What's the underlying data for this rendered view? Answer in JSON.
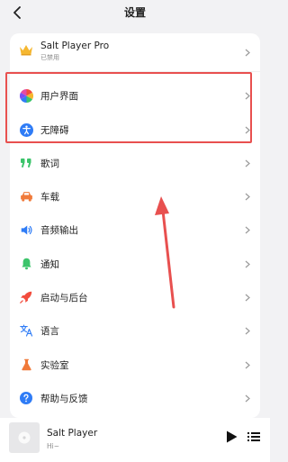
{
  "header": {
    "title": "设置"
  },
  "pro": {
    "title": "Salt Player Pro",
    "subtitle": "已禁用"
  },
  "settings": {
    "items": [
      {
        "label": "用户界面",
        "icon": "color-wheel-icon"
      },
      {
        "label": "无障碍",
        "icon": "accessibility-icon"
      },
      {
        "label": "歌词",
        "icon": "quote-icon"
      },
      {
        "label": "车载",
        "icon": "car-icon"
      },
      {
        "label": "音频输出",
        "icon": "speaker-icon"
      },
      {
        "label": "通知",
        "icon": "bell-icon"
      },
      {
        "label": "启动与后台",
        "icon": "rocket-icon"
      },
      {
        "label": "语言",
        "icon": "translate-icon"
      },
      {
        "label": "实验室",
        "icon": "flask-icon"
      },
      {
        "label": "帮助与反馈",
        "icon": "help-icon"
      }
    ]
  },
  "player": {
    "title": "Salt Player",
    "subtitle": "Hi~"
  },
  "colors": {
    "highlight": "#e8504f",
    "accent_blue": "#2f7cf6",
    "accent_green": "#3cc46b",
    "accent_orange": "#f07a3a"
  }
}
